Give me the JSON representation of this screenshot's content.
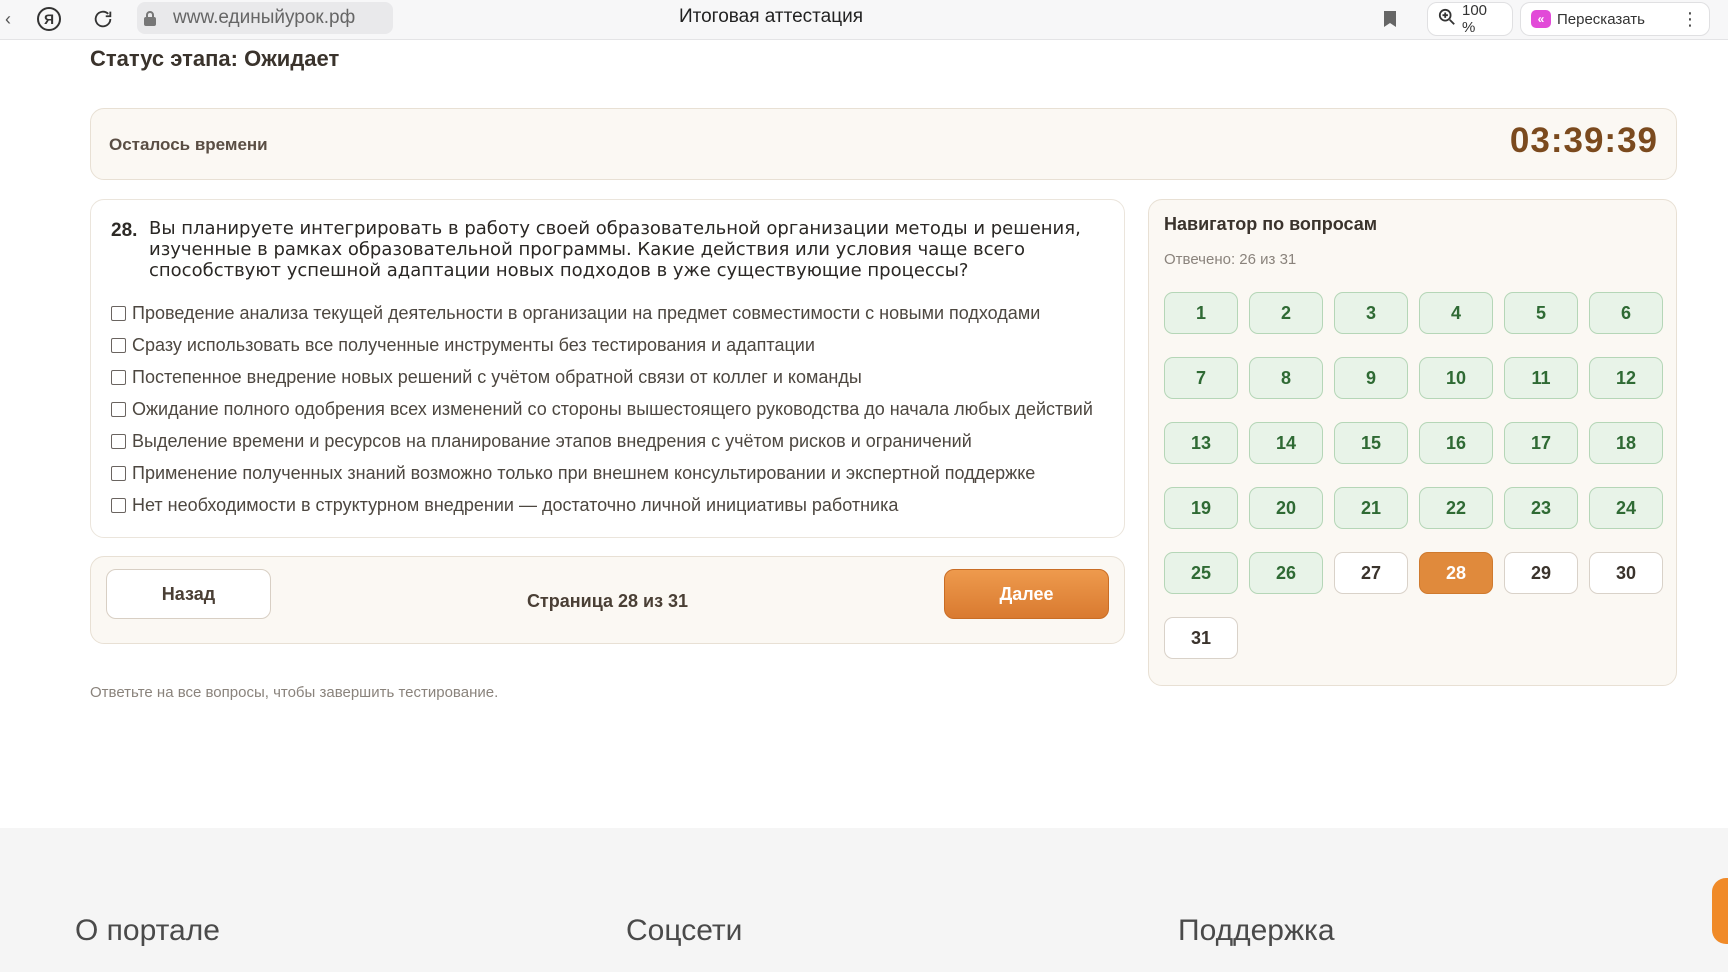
{
  "browser": {
    "url": "www.единыйурок.рф",
    "tab_title": "Итоговая аттестация",
    "zoom": "100 %",
    "retell_label": "Пересказать"
  },
  "status": "Статус этапа: Ожидает",
  "timer": {
    "label": "Осталось времени",
    "value": "03:39:39"
  },
  "question": {
    "number": "28.",
    "text": "Вы планируете интегрировать в работу своей образовательной организации методы и решения, изученные в рамках образовательной программы. Какие действия или условия чаще всего способствуют успешной адаптации новых подходов в уже существующие процессы?",
    "options": [
      "Проведение анализа текущей деятельности в организации на предмет совместимости с новыми подходами",
      "Сразу использовать все полученные инструменты без тестирования и адаптации",
      "Постепенное внедрение новых решений с учётом обратной связи от коллег и команды",
      "Ожидание полного одобрения всех изменений со стороны вышестоящего руководства до начала любых действий",
      "Выделение времени и ресурсов на планирование этапов внедрения с учётом рисков и ограничений",
      "Применение полученных знаний возможно только при внешнем консультировании и экспертной поддержке",
      "Нет необходимости в структурном внедрении — достаточно личной инициативы работника"
    ]
  },
  "pager": {
    "back_label": "Назад",
    "page_indicator": "Страница 28 из 31",
    "next_label": "Далее"
  },
  "hint": "Ответьте на все вопросы, чтобы завершить тестирование.",
  "navigator": {
    "title": "Навигатор по вопросам",
    "answered": "Отвечено: 26 из 31",
    "questions": [
      {
        "n": "1",
        "state": "answered"
      },
      {
        "n": "2",
        "state": "answered"
      },
      {
        "n": "3",
        "state": "answered"
      },
      {
        "n": "4",
        "state": "answered"
      },
      {
        "n": "5",
        "state": "answered"
      },
      {
        "n": "6",
        "state": "answered"
      },
      {
        "n": "7",
        "state": "answered"
      },
      {
        "n": "8",
        "state": "answered"
      },
      {
        "n": "9",
        "state": "answered"
      },
      {
        "n": "10",
        "state": "answered"
      },
      {
        "n": "11",
        "state": "answered"
      },
      {
        "n": "12",
        "state": "answered"
      },
      {
        "n": "13",
        "state": "answered"
      },
      {
        "n": "14",
        "state": "answered"
      },
      {
        "n": "15",
        "state": "answered"
      },
      {
        "n": "16",
        "state": "answered"
      },
      {
        "n": "17",
        "state": "answered"
      },
      {
        "n": "18",
        "state": "answered"
      },
      {
        "n": "19",
        "state": "answered"
      },
      {
        "n": "20",
        "state": "answered"
      },
      {
        "n": "21",
        "state": "answered"
      },
      {
        "n": "22",
        "state": "answered"
      },
      {
        "n": "23",
        "state": "answered"
      },
      {
        "n": "24",
        "state": "answered"
      },
      {
        "n": "25",
        "state": "answered"
      },
      {
        "n": "26",
        "state": "answered"
      },
      {
        "n": "27",
        "state": "unanswered"
      },
      {
        "n": "28",
        "state": "current"
      },
      {
        "n": "29",
        "state": "unanswered"
      },
      {
        "n": "30",
        "state": "unanswered"
      },
      {
        "n": "31",
        "state": "unanswered"
      }
    ]
  },
  "footer": {
    "col1": "О портале",
    "col2": "Соцсети",
    "col3": "Поддержка"
  },
  "colors": {
    "accent": "#e08a3c",
    "timer": "#7b4a1e",
    "answered_bg": "#e8f3e8",
    "answered_text": "#2f6a34"
  }
}
